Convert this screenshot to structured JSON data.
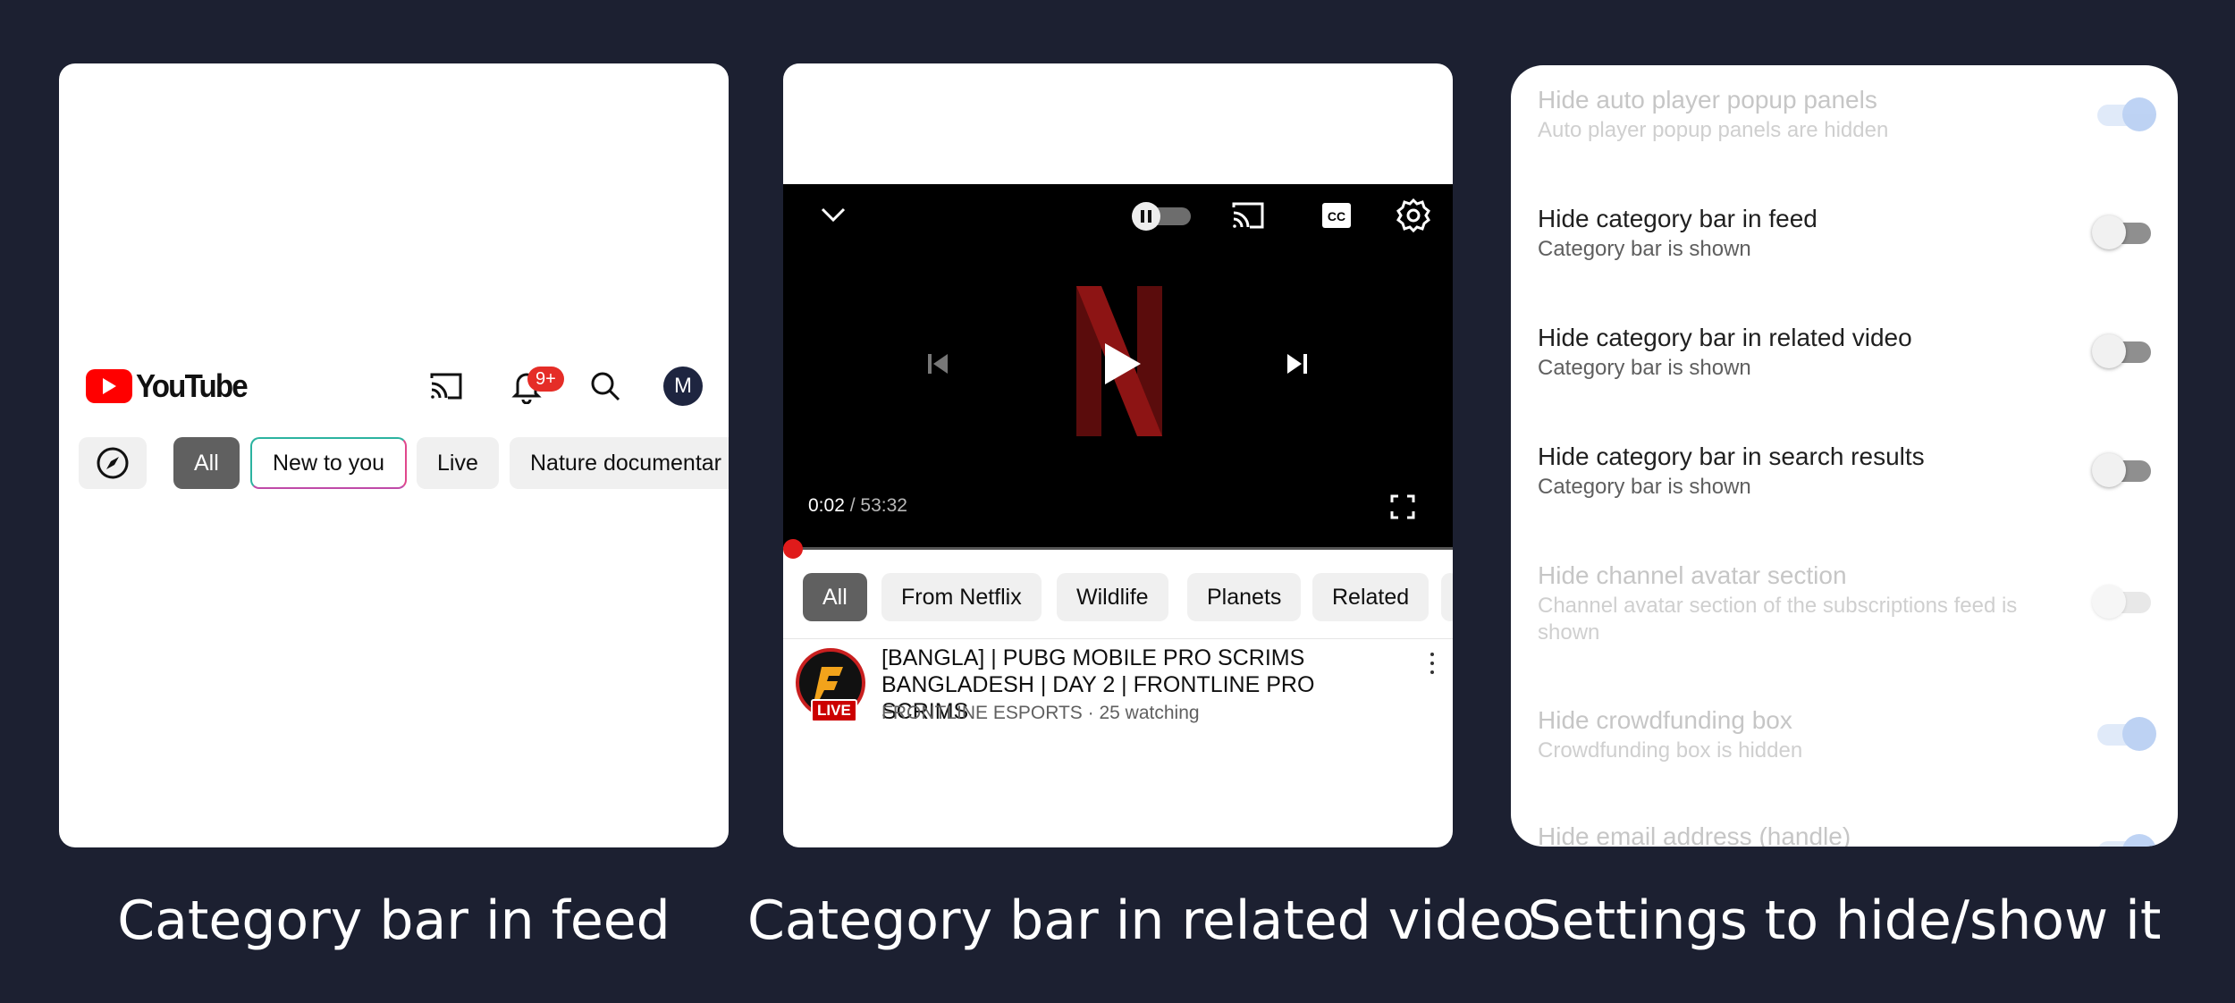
{
  "captions": {
    "feed": "Category bar in feed",
    "related": "Category bar in related video",
    "settings": "Settings to hide/show it"
  },
  "feed": {
    "logo_text": "YouTube",
    "notification_badge": "9+",
    "avatar_letter": "M",
    "chips": [
      "All",
      "New to you",
      "Live",
      "Nature documentar"
    ],
    "active_chip": "All"
  },
  "related": {
    "time_current": "0:02",
    "time_separator": " / ",
    "time_total": "53:32",
    "chips": [
      "All",
      "From Netflix",
      "Wildlife",
      "Planets",
      "Related"
    ],
    "video": {
      "title": "[BANGLA] | PUBG MOBILE PRO SCRIMS BANGLADESH | DAY 2 | FRONTLINE PRO SCRIMS",
      "meta": "FRONTLINE ESPORTS · 25 watching",
      "live_badge": "LIVE"
    }
  },
  "settings": {
    "items": [
      {
        "title": "Hide auto player popup panels",
        "subtitle": "Auto player popup panels are hidden",
        "enabled": false,
        "checked": true
      },
      {
        "title": "Hide category bar in feed",
        "subtitle": "Category bar is shown",
        "enabled": true,
        "checked": false
      },
      {
        "title": "Hide category bar in related video",
        "subtitle": "Category bar is shown",
        "enabled": true,
        "checked": false
      },
      {
        "title": "Hide category bar in search results",
        "subtitle": "Category bar is shown",
        "enabled": true,
        "checked": false
      },
      {
        "title": "Hide channel avatar section",
        "subtitle": "Channel avatar section of the subscriptions feed is shown",
        "enabled": false,
        "checked": false
      },
      {
        "title": "Hide crowdfunding box",
        "subtitle": "Crowdfunding box is hidden",
        "enabled": false,
        "checked": true
      },
      {
        "title": "Hide email address (handle)",
        "subtitle": "",
        "enabled": false,
        "checked": true
      }
    ]
  },
  "colors": {
    "background": "#1c2031",
    "youtube_red": "#ff0000",
    "toggle_on": "#a8c4f0"
  }
}
